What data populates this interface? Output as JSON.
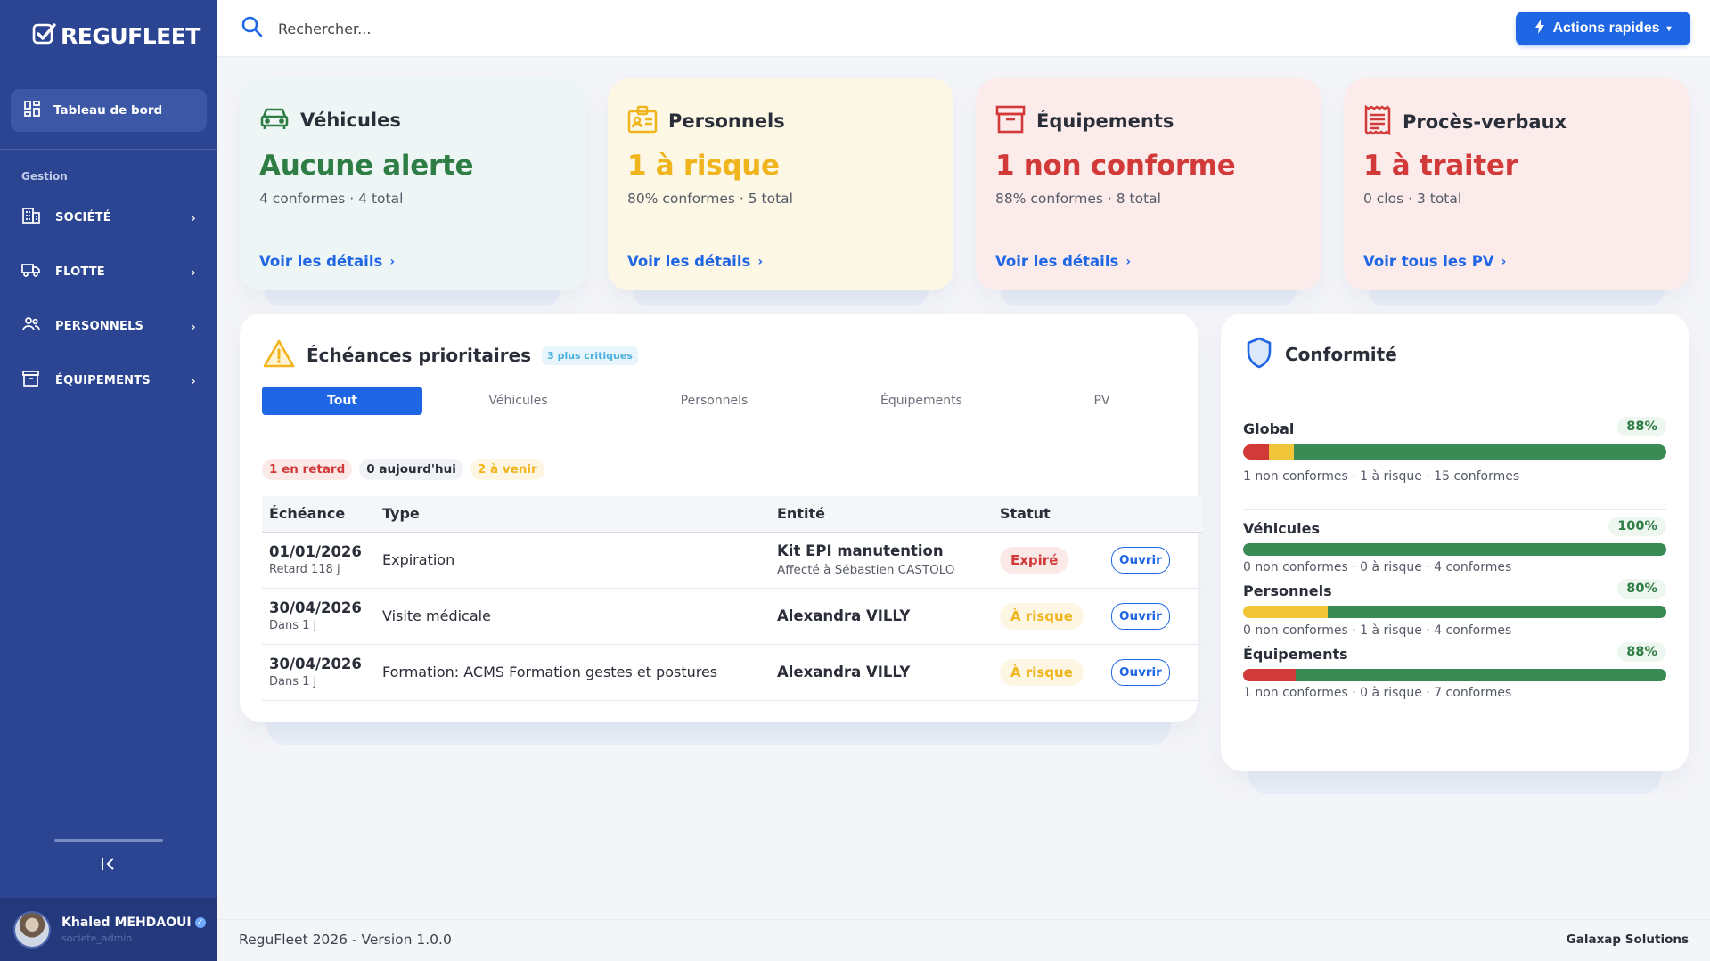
{
  "brand": {
    "name": "REGUFLEET"
  },
  "sidebar": {
    "active": {
      "label": "Tableau de bord"
    },
    "section": "Gestion",
    "items": [
      {
        "label": "SOCIÉTÉ"
      },
      {
        "label": "FLOTTE"
      },
      {
        "label": "PERSONNELS"
      },
      {
        "label": "ÉQUIPEMENTS"
      }
    ],
    "user": {
      "name": "Khaled MEHDAOUI",
      "role": "societe_admin"
    }
  },
  "topbar": {
    "search_placeholder": "Rechercher...",
    "quick_actions": "Actions rapides"
  },
  "stats": [
    {
      "title": "Véhicules",
      "big": "Aucune alerte",
      "sub": "4 conformes · 4 total",
      "link": "Voir les détails",
      "color": "#2e7d45",
      "bg": "#eef6f5"
    },
    {
      "title": "Personnels",
      "big": "1 à risque",
      "sub": "80% conformes · 5 total",
      "link": "Voir les détails",
      "color": "#f0b41c",
      "bg": "#fdf7e6"
    },
    {
      "title": "Équipements",
      "big": "1 non conforme",
      "sub": "88% conformes · 8 total",
      "link": "Voir les détails",
      "color": "#d23a3a",
      "bg": "#fbeceb"
    },
    {
      "title": "Procès-verbaux",
      "big": "1 à traiter",
      "sub": "0 clos · 3 total",
      "link": "Voir tous les PV",
      "color": "#d23a3a",
      "bg": "#fbeceb"
    }
  ],
  "deadlines": {
    "title": "Échéances prioritaires",
    "badge": "3 plus critiques",
    "tabs": [
      "Tout",
      "Véhicules",
      "Personnels",
      "Équipements",
      "PV"
    ],
    "chips": [
      {
        "label": "1 en retard",
        "color": "#d23a3a",
        "bg": "#fbe9e8"
      },
      {
        "label": "0 aujourd'hui",
        "color": "#2a2e38",
        "bg": "#f1f2f5"
      },
      {
        "label": "2 à venir",
        "color": "#f0b41c",
        "bg": "#fdf6e3"
      }
    ],
    "columns": [
      "Échéance",
      "Type",
      "Entité",
      "Statut"
    ],
    "rows": [
      {
        "date": "01/01/2026",
        "rel": "Retard 118 j",
        "type": "Expiration",
        "entity": "Kit EPI manutention",
        "entity_sub": "Affecté à Sébastien CASTOLO",
        "status": "Expiré",
        "status_color": "#d23a3a",
        "status_bg": "#fbe9e8",
        "action": "Ouvrir"
      },
      {
        "date": "30/04/2026",
        "rel": "Dans 1 j",
        "type": "Visite médicale",
        "entity": "Alexandra VILLY",
        "entity_sub": "",
        "status": "À risque",
        "status_color": "#f0b41c",
        "status_bg": "#fdf6e3",
        "action": "Ouvrir"
      },
      {
        "date": "30/04/2026",
        "rel": "Dans 1 j",
        "type": "Formation: ACMS Formation gestes et postures",
        "entity": "Alexandra VILLY",
        "entity_sub": "",
        "status": "À risque",
        "status_color": "#f0b41c",
        "status_bg": "#fdf6e3",
        "action": "Ouvrir"
      }
    ]
  },
  "conformite": {
    "title": "Conformité",
    "rows": [
      {
        "label": "Global",
        "pct": "88%",
        "red": 1,
        "yellow": 1,
        "green": 15,
        "note": "1 non conformes · 1 à risque · 15 conformes"
      },
      {
        "label": "Véhicules",
        "pct": "100%",
        "red": 0,
        "yellow": 0,
        "green": 4,
        "note": "0 non conformes · 0 à risque · 4 conformes"
      },
      {
        "label": "Personnels",
        "pct": "80%",
        "red": 0,
        "yellow": 1,
        "green": 4,
        "note": "0 non conformes · 1 à risque · 4 conformes"
      },
      {
        "label": "Équipements",
        "pct": "88%",
        "red": 1,
        "yellow": 0,
        "green": 7,
        "note": "1 non conformes · 0 à risque · 7 conformes"
      }
    ]
  },
  "footer": {
    "left": "ReguFleet 2026 - Version 1.0.0",
    "right": "Galaxap Solutions"
  }
}
